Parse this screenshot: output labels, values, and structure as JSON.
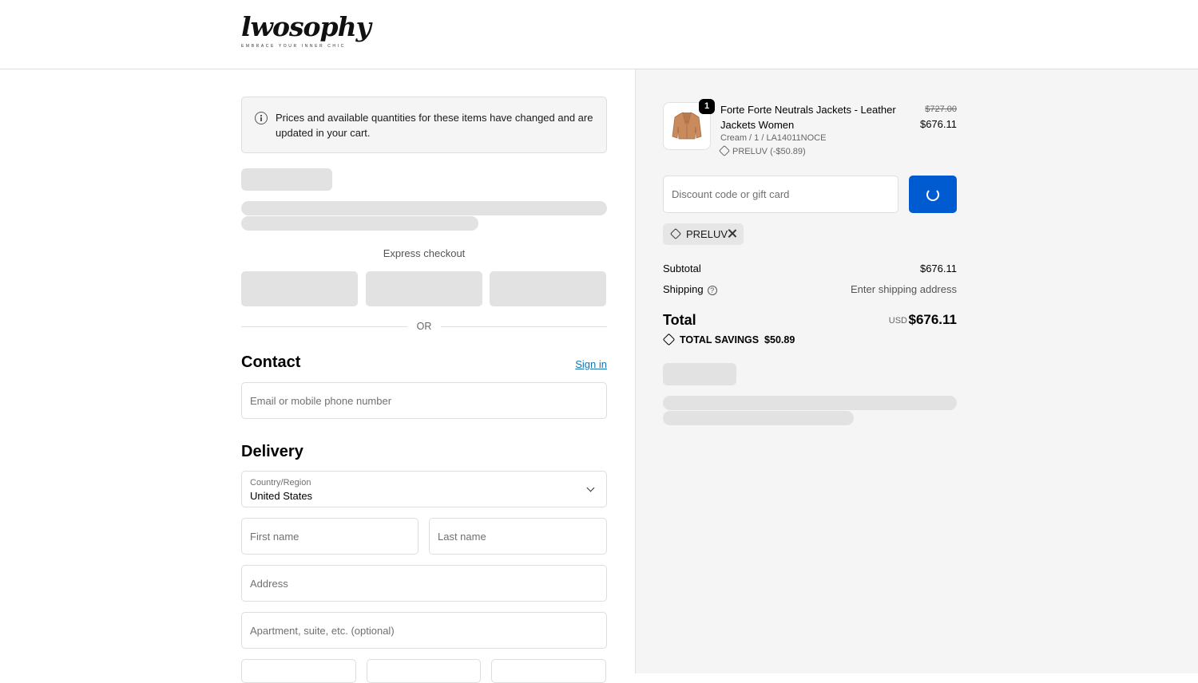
{
  "brand": {
    "name": "lwosophy",
    "tagline": "EMBRACE YOUR INNER CHIC"
  },
  "notice": {
    "text": "Prices and available quantities for these items have changed and are updated in your cart."
  },
  "express": {
    "label": "Express checkout",
    "or_label": "OR"
  },
  "contact": {
    "heading": "Contact",
    "sign_in": "Sign in",
    "email_placeholder": "Email or mobile phone number"
  },
  "delivery": {
    "heading": "Delivery",
    "country_label": "Country/Region",
    "country_value": "United States",
    "first_name_placeholder": "First name",
    "last_name_placeholder": "Last name",
    "address_placeholder": "Address",
    "apartment_placeholder": "Apartment, suite, etc. (optional)"
  },
  "order": {
    "item": {
      "quantity": "1",
      "name": "Forte Forte Neutrals Jackets - Leather Jackets Women",
      "variant": "Cream / 1 / LA14011NOCE",
      "discount": "PRELUV (-$50.89)",
      "price_original": "$727.00",
      "price_current": "$676.11"
    },
    "discount_placeholder": "Discount code or gift card",
    "applied_code": "PRELUV",
    "subtotal_label": "Subtotal",
    "subtotal_value": "$676.11",
    "shipping_label": "Shipping",
    "shipping_value": "Enter shipping address",
    "total_label": "Total",
    "currency": "USD",
    "total_value": "$676.11",
    "savings_label": "TOTAL SAVINGS",
    "savings_value": "$50.89"
  },
  "colors": {
    "primary": "#005bd1",
    "link": "#1773b0",
    "panel_bg": "#f5f5f5",
    "skeleton": "#e2e2e2"
  }
}
